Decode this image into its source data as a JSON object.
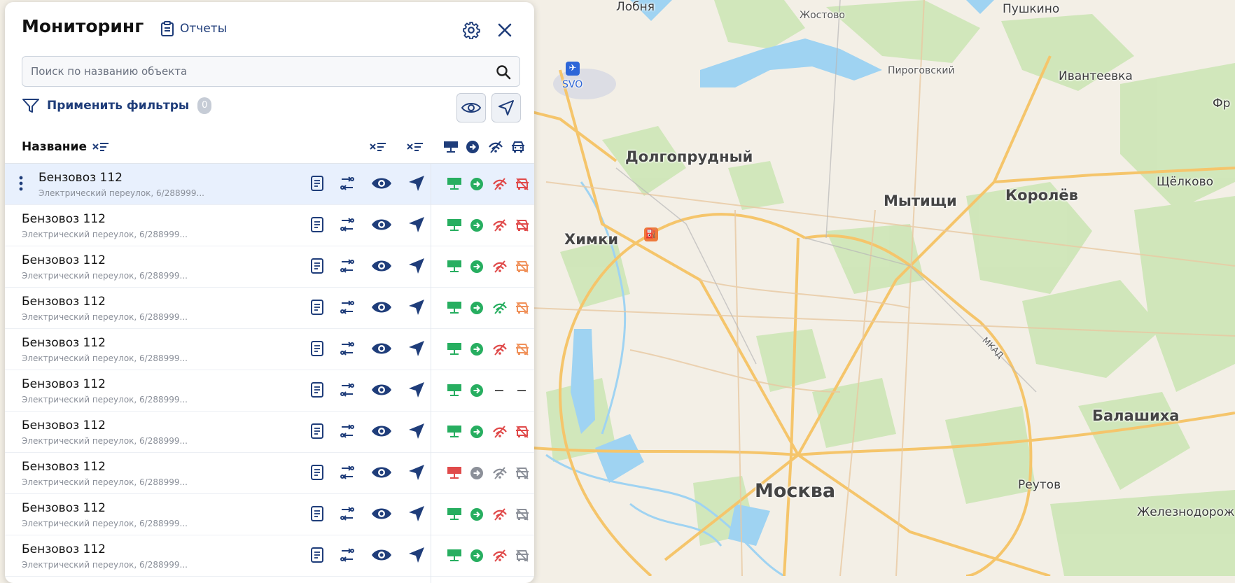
{
  "panel": {
    "title": "Мониторинг",
    "reports_label": "Отчеты",
    "search_placeholder": "Поиск по названию объекта",
    "filters_label": "Применить фильтры",
    "filters_count": "0",
    "column_name": "Название"
  },
  "rows": [
    {
      "name": "Бензовоз 112",
      "address": "Электрический переулок, 6/288999...",
      "selected": true,
      "power": "green",
      "move": "green",
      "signal": "red",
      "car": "red"
    },
    {
      "name": "Бензовоз 112",
      "address": "Электрический переулок, 6/288999...",
      "selected": false,
      "power": "green",
      "move": "green",
      "signal": "red",
      "car": "red"
    },
    {
      "name": "Бензовоз 112",
      "address": "Электрический переулок, 6/288999...",
      "selected": false,
      "power": "green",
      "move": "green",
      "signal": "red",
      "car": "orange"
    },
    {
      "name": "Бензовоз 112",
      "address": "Электрический переулок, 6/288999...",
      "selected": false,
      "power": "green",
      "move": "green",
      "signal": "green",
      "car": "orange"
    },
    {
      "name": "Бензовоз 112",
      "address": "Электрический переулок, 6/288999...",
      "selected": false,
      "power": "green",
      "move": "green",
      "signal": "red",
      "car": "orange"
    },
    {
      "name": "Бензовоз 112",
      "address": "Электрический переулок, 6/288999...",
      "selected": false,
      "power": "green",
      "move": "green",
      "signal": "none",
      "car": "none"
    },
    {
      "name": "Бензовоз 112",
      "address": "Электрический переулок, 6/288999...",
      "selected": false,
      "power": "green",
      "move": "green",
      "signal": "red",
      "car": "red"
    },
    {
      "name": "Бензовоз 112",
      "address": "Электрический переулок, 6/288999...",
      "selected": false,
      "power": "red",
      "move": "gray",
      "signal": "gray",
      "car": "gray"
    },
    {
      "name": "Бензовоз 112",
      "address": "Электрический переулок, 6/288999...",
      "selected": false,
      "power": "green",
      "move": "green",
      "signal": "red",
      "car": "gray"
    },
    {
      "name": "Бензовоз 112",
      "address": "Электрический переулок, 6/288999...",
      "selected": false,
      "power": "green",
      "move": "green",
      "signal": "red",
      "car": "gray"
    }
  ],
  "status_colors": {
    "green": "#27ae60",
    "red": "#e04a4a",
    "orange": "#f0915a",
    "gray": "#8c9099",
    "navy": "#1f3d7a"
  },
  "map": {
    "labels": [
      {
        "text": "Лобня",
        "size": "small"
      },
      {
        "text": "Жостово",
        "size": "xs"
      },
      {
        "text": "Пушкино",
        "size": "small"
      },
      {
        "text": "SVO",
        "size": "xs"
      },
      {
        "text": "Пироговский",
        "size": "xs"
      },
      {
        "text": "Ивантеевка",
        "size": "small"
      },
      {
        "text": "Фр",
        "size": "small"
      },
      {
        "text": "Долгопрудный",
        "size": "med"
      },
      {
        "text": "Мытищи",
        "size": "med"
      },
      {
        "text": "Королёв",
        "size": "med"
      },
      {
        "text": "Щёлково",
        "size": "small"
      },
      {
        "text": "Химки",
        "size": "med"
      },
      {
        "text": "МКАД",
        "size": "xs"
      },
      {
        "text": "Балашиха",
        "size": "med"
      },
      {
        "text": "Москва",
        "size": "big"
      },
      {
        "text": "Реутов",
        "size": "small"
      },
      {
        "text": "Железнодорож",
        "size": "small"
      }
    ]
  }
}
